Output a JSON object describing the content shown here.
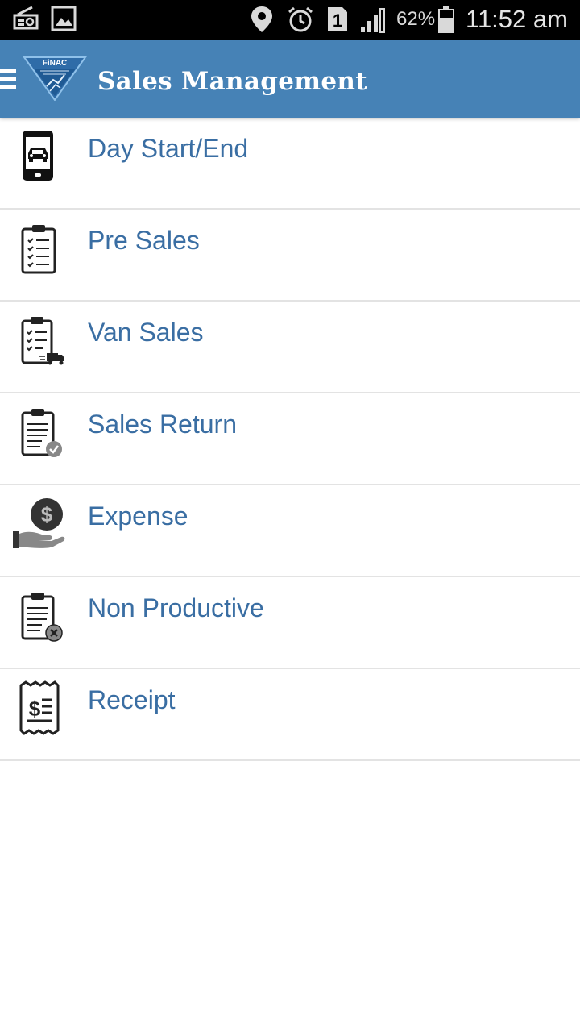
{
  "status_bar": {
    "battery_percent": "62%",
    "time": "11:52 am",
    "icons": [
      "radio-icon",
      "gallery-icon",
      "location-icon",
      "alarm-icon",
      "sim-icon",
      "signal-icon",
      "battery-icon"
    ]
  },
  "app_bar": {
    "title": "Sales Management",
    "logo_text": "FiNAC",
    "color": "#4682b6"
  },
  "menu": {
    "label_color": "#3a6ea3",
    "items": [
      {
        "label": "Day Start/End",
        "icon": "phone-car-icon"
      },
      {
        "label": "Pre Sales",
        "icon": "clipboard-checklist-icon"
      },
      {
        "label": "Van Sales",
        "icon": "clipboard-truck-icon"
      },
      {
        "label": "Sales Return",
        "icon": "clipboard-check-icon"
      },
      {
        "label": "Expense",
        "icon": "hand-coin-icon"
      },
      {
        "label": "Non Productive",
        "icon": "clipboard-cancel-icon"
      },
      {
        "label": "Receipt",
        "icon": "receipt-icon"
      }
    ]
  }
}
